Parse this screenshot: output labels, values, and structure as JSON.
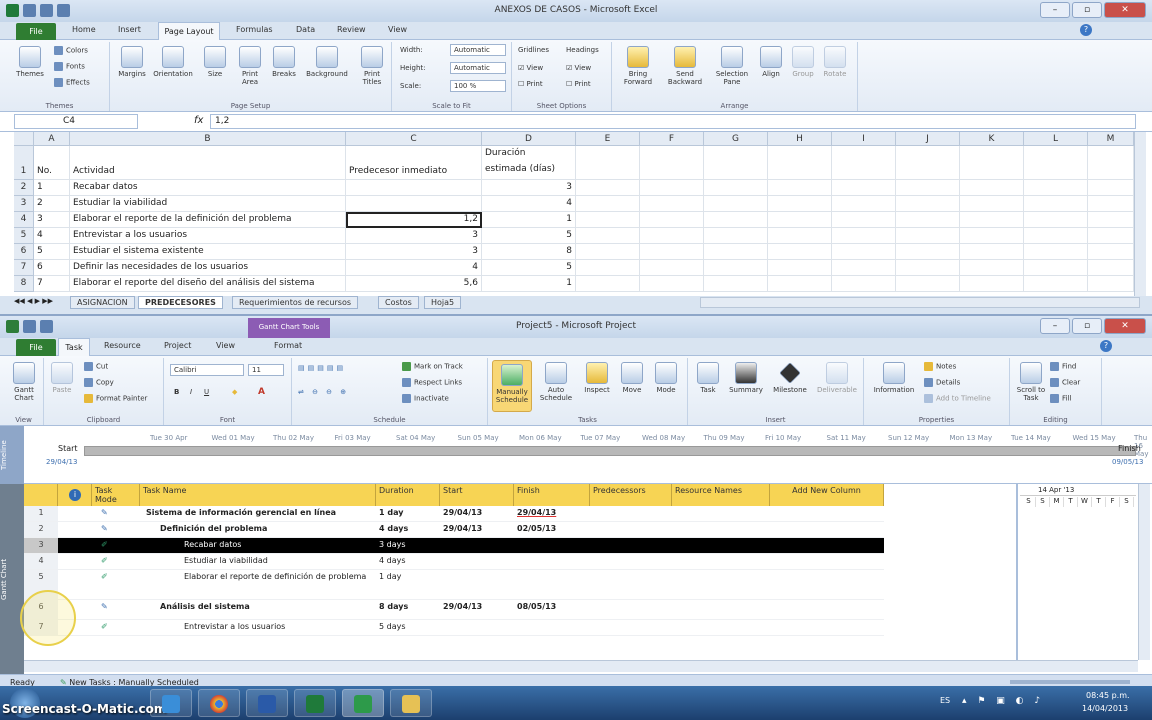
{
  "excel": {
    "title": "ANEXOS DE CASOS - Microsoft Excel",
    "tabs": [
      "File",
      "Home",
      "Insert",
      "Page Layout",
      "Formulas",
      "Data",
      "Review",
      "View"
    ],
    "active_tab": "Page Layout",
    "ribbon": {
      "themes": {
        "label": "Themes",
        "colors": "Colors",
        "fonts": "Fonts",
        "effects": "Effects",
        "group": "Themes"
      },
      "page_setup": {
        "items": [
          "Margins",
          "Orientation",
          "Size",
          "Print Area",
          "Breaks",
          "Background",
          "Print Titles"
        ],
        "group": "Page Setup"
      },
      "scale": {
        "width_label": "Width:",
        "width_value": "Automatic",
        "height_label": "Height:",
        "height_value": "Automatic",
        "scale_label": "Scale:",
        "scale_value": "100 %",
        "group": "Scale to Fit"
      },
      "sheet_options": {
        "gridlines": "Gridlines",
        "headings": "Headings",
        "view": "View",
        "print": "Print",
        "group": "Sheet Options"
      },
      "arrange": {
        "items": [
          "Bring Forward",
          "Send Backward",
          "Selection Pane",
          "Align",
          "Group",
          "Rotate"
        ],
        "group": "Arrange"
      }
    },
    "name_box": "C4",
    "formula": "1,2",
    "columns": [
      "A",
      "B",
      "C",
      "D",
      "E",
      "F",
      "G",
      "H",
      "I",
      "J",
      "K",
      "L",
      "M"
    ],
    "header_row": {
      "a": "No.",
      "b": "Actividad",
      "c": "Predecesor inmediato",
      "d1": "Duración",
      "d2": "estimada (días)"
    },
    "rows": [
      {
        "n": "2",
        "a": "1",
        "b": "Recabar datos",
        "c": "",
        "d": "3"
      },
      {
        "n": "3",
        "a": "2",
        "b": "Estudiar la viabilidad",
        "c": "",
        "d": "4"
      },
      {
        "n": "4",
        "a": "3",
        "b": "Elaborar el reporte de la definición del problema",
        "c": "1,2",
        "d": "1"
      },
      {
        "n": "5",
        "a": "4",
        "b": "Entrevistar a los usuarios",
        "c": "3",
        "d": "5"
      },
      {
        "n": "6",
        "a": "5",
        "b": "Estudiar el sistema existente",
        "c": "3",
        "d": "8"
      },
      {
        "n": "7",
        "a": "6",
        "b": "Definir las necesidades de los usuarios",
        "c": "4",
        "d": "5"
      },
      {
        "n": "8",
        "a": "7",
        "b": "Elaborar el reporte del diseño del análisis del sistema",
        "c": "5,6",
        "d": "1"
      }
    ],
    "sheets": [
      "ASIGNACION",
      "PREDECESORES",
      "Requerimientos de recursos",
      "Costos",
      "Hoja5"
    ],
    "active_sheet": "PREDECESORES"
  },
  "project": {
    "title": "Project5 - Microsoft Project",
    "context_tab": "Gantt Chart Tools",
    "tabs": [
      "File",
      "Task",
      "Resource",
      "Project",
      "View",
      "Format"
    ],
    "active_tab": "Task",
    "ribbon": {
      "view": {
        "label": "Gantt Chart",
        "group": "View"
      },
      "clipboard": {
        "paste": "Paste",
        "cut": "Cut",
        "copy": "Copy",
        "format_painter": "Format Painter",
        "group": "Clipboard"
      },
      "font": {
        "name": "Calibri",
        "size": "11",
        "group": "Font"
      },
      "schedule": {
        "mark": "Mark on Track",
        "respect": "Respect Links",
        "inactivate": "Inactivate",
        "group": "Schedule"
      },
      "tasks": {
        "items": [
          "Manually Schedule",
          "Auto Schedule",
          "Inspect",
          "Move",
          "Mode"
        ],
        "group": "Tasks"
      },
      "insert": {
        "items": [
          "Task",
          "Summary",
          "Milestone",
          "Deliverable"
        ],
        "group": "Insert"
      },
      "properties": {
        "info": "Information",
        "notes": "Notes",
        "details": "Details",
        "timeline": "Add to Timeline",
        "group": "Properties"
      },
      "editing": {
        "scroll": "Scroll to Task",
        "find": "Find",
        "clear": "Clear",
        "fill": "Fill",
        "group": "Editing"
      }
    },
    "timeline": {
      "side_label": "Timeline",
      "dates": [
        "Tue 30 Apr",
        "Wed 01 May",
        "Thu 02 May",
        "Fri 03 May",
        "Sat 04 May",
        "Sun 05 May",
        "Mon 06 May",
        "Tue 07 May",
        "Wed 08 May",
        "Thu 09 May",
        "Fri 10 May",
        "Sat 11 May",
        "Sun 12 May",
        "Mon 13 May",
        "Tue 14 May",
        "Wed 15 May",
        "Thu 16 May"
      ],
      "start_label": "Start",
      "start_date": "29/04/13",
      "finish_label": "Finish",
      "finish_date": "09/05/13"
    },
    "side_label": "Gantt Chart",
    "columns": [
      "Task Mode",
      "Task Name",
      "Duration",
      "Start",
      "Finish",
      "Predecessors",
      "Resource Names",
      "Add New Column"
    ],
    "info_icon": "i",
    "rows": [
      {
        "id": "1",
        "name": "Sistema de información gerencial en línea",
        "dur": "1 day",
        "start": "29/04/13",
        "finish": "29/04/13",
        "bold": true,
        "indent": 0,
        "summary": true
      },
      {
        "id": "2",
        "name": "Definición del problema",
        "dur": "4 days",
        "start": "29/04/13",
        "finish": "02/05/13",
        "bold": true,
        "indent": 1,
        "summary": true
      },
      {
        "id": "3",
        "name": "Recabar datos",
        "dur": "3 days",
        "start": "",
        "finish": "",
        "bold": false,
        "indent": 2,
        "selected": true
      },
      {
        "id": "4",
        "name": "Estudiar la viabilidad",
        "dur": "4 days",
        "start": "",
        "finish": "",
        "bold": false,
        "indent": 2
      },
      {
        "id": "5",
        "name": "Elaborar el reporte de definición de problema",
        "dur": "1 day",
        "start": "",
        "finish": "",
        "bold": false,
        "indent": 2
      },
      {
        "id": "6",
        "name": "Análisis del sistema",
        "dur": "8 days",
        "start": "29/04/13",
        "finish": "08/05/13",
        "bold": true,
        "indent": 1,
        "summary": true
      },
      {
        "id": "7",
        "name": "Entrevistar a los usuarios",
        "dur": "5 days",
        "start": "",
        "finish": "",
        "bold": false,
        "indent": 2
      }
    ],
    "chart_header": {
      "week": "14 Apr '13",
      "days": [
        "S",
        "S",
        "M",
        "T",
        "W",
        "T",
        "F",
        "S"
      ]
    },
    "status": {
      "ready": "Ready",
      "new_tasks": "New Tasks : Manually Scheduled"
    }
  },
  "taskbar": {
    "watermark": "Screencast-O-Matic.com",
    "lang": "ES",
    "time": "08:45 p.m.",
    "date": "14/04/2013"
  }
}
